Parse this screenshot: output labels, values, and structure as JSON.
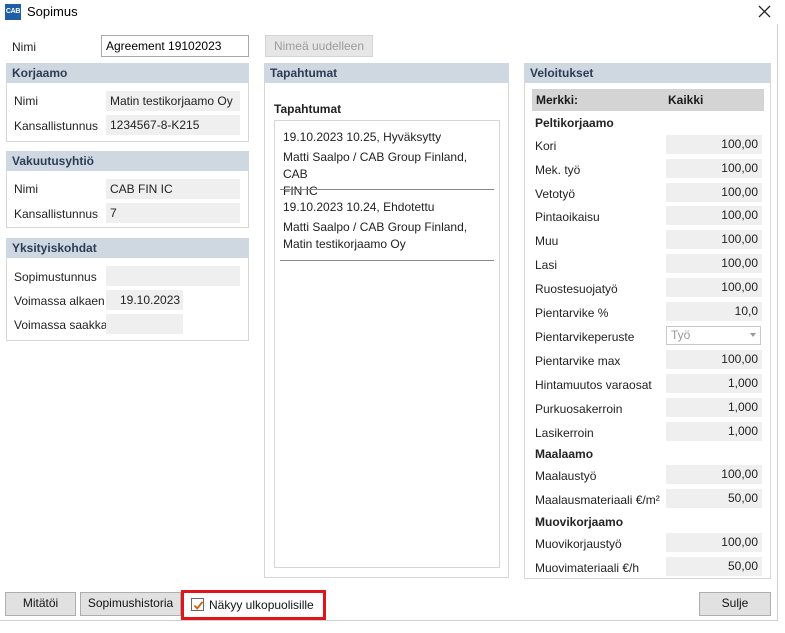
{
  "window": {
    "icon_text": "CAB",
    "title": "Sopimus"
  },
  "top": {
    "name_label": "Nimi",
    "name_value": "Agreement 19102023",
    "rename_button": "Nimeä uudelleen"
  },
  "korjaamo": {
    "header": "Korjaamo",
    "name_label": "Nimi",
    "name_value": "Matin testikorjaamo Oy",
    "id_label": "Kansallistunnus",
    "id_value": "1234567-8-K215"
  },
  "vakuutusyhtio": {
    "header": "Vakuutusyhtiö",
    "name_label": "Nimi",
    "name_value": "CAB FIN IC",
    "id_label": "Kansallistunnus",
    "id_value": "7"
  },
  "yksityiskohdat": {
    "header": "Yksityiskohdat",
    "contract_no_label": "Sopimustunnus",
    "contract_no_value": "",
    "valid_from_label": "Voimassa alkaen",
    "valid_from_value": "19.10.2023",
    "valid_to_label": "Voimassa saakka",
    "valid_to_value": ""
  },
  "tapahtumat": {
    "header": "Tapahtumat",
    "list_title": "Tapahtumat",
    "events": [
      {
        "line1": "19.10.2023 10.25, Hyväksytty",
        "line2": "Matti Saalpo / CAB Group Finland, CAB",
        "line3": "FIN IC"
      },
      {
        "line1": "19.10.2023 10.24, Ehdotettu",
        "line2": "Matti Saalpo / CAB Group Finland,",
        "line3": "Matin testikorjaamo Oy"
      }
    ]
  },
  "veloitukset": {
    "header": "Veloitukset",
    "col_brand": "Merkki:",
    "col_all": "Kaikki",
    "cat_pelti": "Peltikorjaamo",
    "cat_maalaamo": "Maalaamo",
    "cat_muovi": "Muovikorjaamo",
    "rows": [
      {
        "label": "Kori",
        "value": "100,00"
      },
      {
        "label": "Mek. työ",
        "value": "100,00"
      },
      {
        "label": "Vetotyö",
        "value": "100,00"
      },
      {
        "label": "Pintaoikaisu",
        "value": "100,00"
      },
      {
        "label": "Muu",
        "value": "100,00"
      },
      {
        "label": "Lasi",
        "value": "100,00"
      },
      {
        "label": "Ruostesuojatyö",
        "value": "100,00"
      },
      {
        "label": "Pientarvike %",
        "value": "10,0"
      },
      {
        "label": "Pientarvikeperuste",
        "value": "Työ"
      },
      {
        "label": "Pientarvike max",
        "value": "100,00"
      },
      {
        "label": "Hintamuutos varaosat",
        "value": "1,000"
      },
      {
        "label": "Purkuosakerroin",
        "value": "1,000"
      },
      {
        "label": "Lasikerroin",
        "value": "1,000"
      },
      {
        "label": "Maalaustyö",
        "value": "100,00"
      },
      {
        "label": "Maalausmateriaali €/m²",
        "value": "50,00"
      },
      {
        "label": "Muovikorjaustyö",
        "value": "100,00"
      },
      {
        "label": "Muovimateriaali €/h",
        "value": "50,00"
      }
    ]
  },
  "footer": {
    "cancel_button": "Mitätöi",
    "history_button": "Sopimushistoria",
    "visible_checkbox_label": "Näkyy ulkopuolisille",
    "visible_checked": true,
    "close_button": "Sulje"
  },
  "colors": {
    "accent_highlight": "#e0151b",
    "panel_header": "#cfd8e0",
    "value_bg": "#efefef"
  },
  "icons": {
    "close": "close-icon",
    "checkbox": "checkmark-icon",
    "dropdown": "chevron-down-icon"
  }
}
